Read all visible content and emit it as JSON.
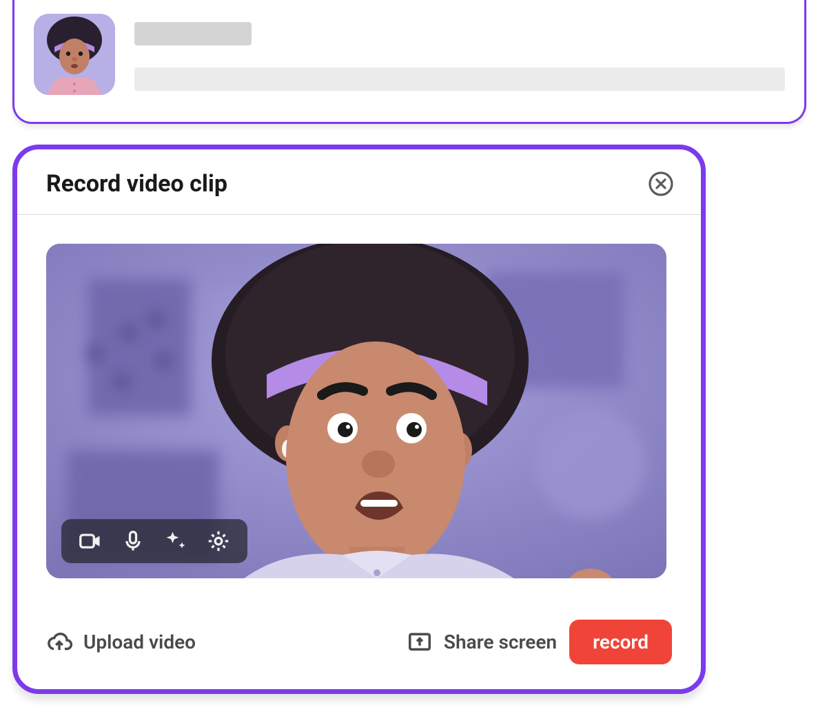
{
  "item": {
    "avatar_alt": "user-avatar"
  },
  "dialog": {
    "title": "Record video clip",
    "close_label": "Close",
    "toolbar": {
      "camera": "camera",
      "mic": "microphone",
      "effects": "effects",
      "settings": "settings"
    },
    "footer": {
      "upload": "Upload video",
      "share": "Share screen",
      "record": "record"
    }
  },
  "colors": {
    "accent": "#7c3aed",
    "danger": "#f04438"
  }
}
